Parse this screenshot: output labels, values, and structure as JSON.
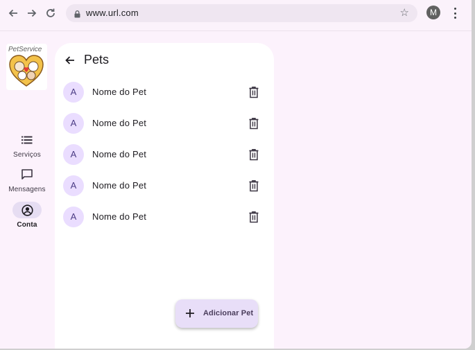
{
  "browser": {
    "url": "www.url.com",
    "profile_initial": "M"
  },
  "app": {
    "logo_text": "PetService"
  },
  "nav_rail": {
    "items": [
      {
        "label": "Serviços",
        "icon": "list-icon",
        "active": false
      },
      {
        "label": "Mensagens",
        "icon": "chat-icon",
        "active": false
      },
      {
        "label": "Conta",
        "icon": "account-circle-icon",
        "active": true
      }
    ]
  },
  "page": {
    "title": "Pets"
  },
  "pets": [
    {
      "avatar": "A",
      "name": "Nome do Pet"
    },
    {
      "avatar": "A",
      "name": "Nome do Pet"
    },
    {
      "avatar": "A",
      "name": "Nome do Pet"
    },
    {
      "avatar": "A",
      "name": "Nome do Pet"
    },
    {
      "avatar": "A",
      "name": "Nome do Pet"
    }
  ],
  "fab": {
    "label": "Adicionar Pet"
  },
  "colors": {
    "background": "#fcf2fc",
    "surface": "#ffffff",
    "avatar_bg": "#eaddff",
    "fab_bg": "#e8def8",
    "active_indicator": "#e6ddf2"
  }
}
